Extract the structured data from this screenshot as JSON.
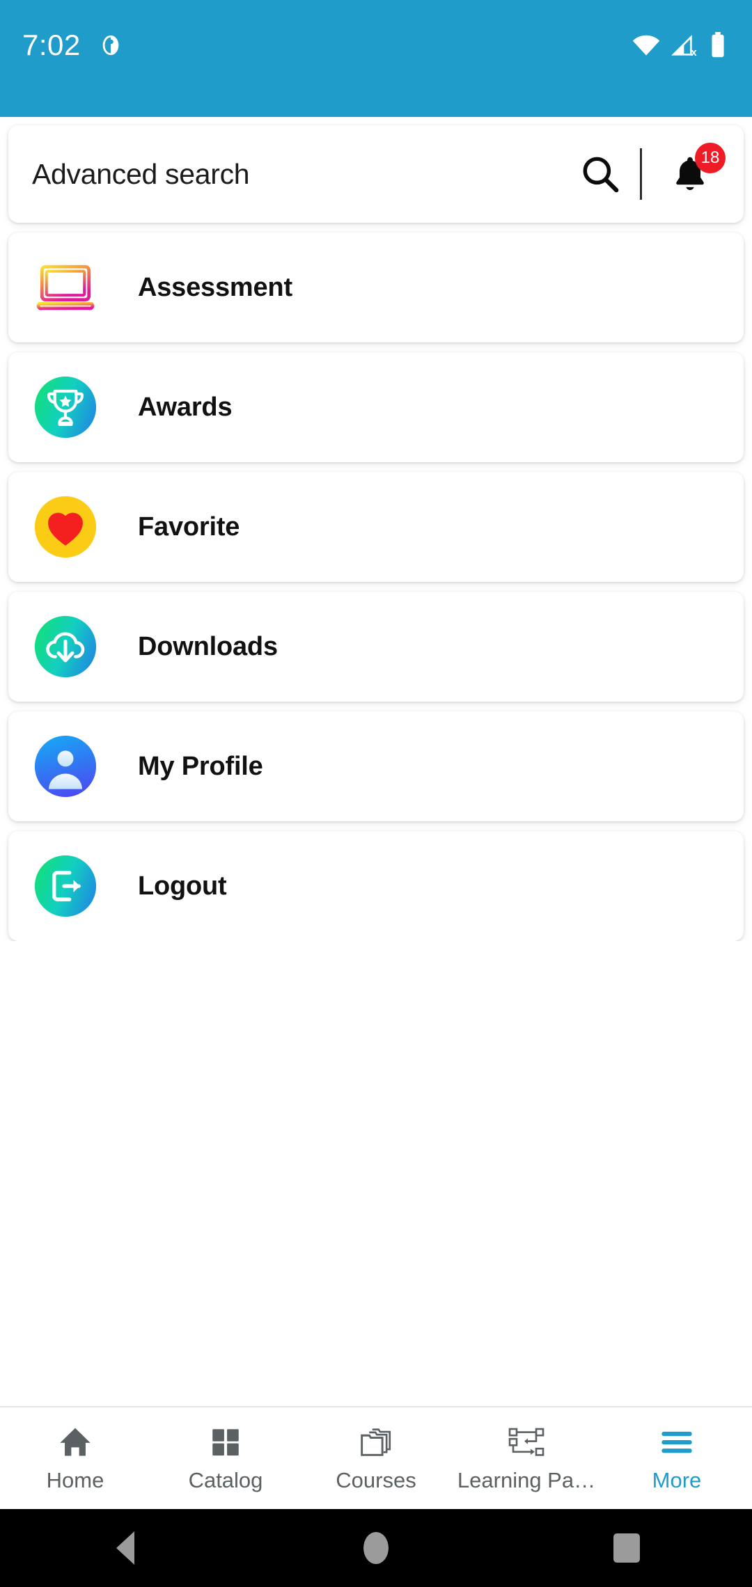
{
  "status_bar": {
    "time": "7:02",
    "app_icon": "app-notification-icon",
    "wifi_icon": "wifi-icon",
    "cellular_icon": "cellular-no-sim-icon",
    "battery_icon": "battery-icon",
    "background_color": "#1f9cc9"
  },
  "search": {
    "value": "Advanced search",
    "placeholder": "Advanced search",
    "search_icon": "search-icon",
    "bell_icon": "bell-icon",
    "notification_count": "18",
    "badge_color": "#ef1b26"
  },
  "menu": {
    "items": [
      {
        "label": "Assessment",
        "icon": "laptop-outline-icon",
        "icon_style": "outline-gradient-yellow-magenta"
      },
      {
        "label": "Awards",
        "icon": "trophy-icon",
        "icon_style": "circle-gradient-green-blue"
      },
      {
        "label": "Favorite",
        "icon": "heart-icon",
        "icon_style": "circle-yellow-red-heart"
      },
      {
        "label": "Downloads",
        "icon": "cloud-download-icon",
        "icon_style": "circle-gradient-green-blue"
      },
      {
        "label": "My Profile",
        "icon": "person-icon",
        "icon_style": "circle-gradient-cyan-indigo"
      },
      {
        "label": "Logout",
        "icon": "logout-icon",
        "icon_style": "circle-gradient-green-blue"
      }
    ]
  },
  "bottom_nav": {
    "active_color": "#1f9cc9",
    "inactive_color": "#5b6063",
    "items": [
      {
        "label": "Home",
        "icon": "home-icon",
        "active": false
      },
      {
        "label": "Catalog",
        "icon": "grid-icon",
        "active": false
      },
      {
        "label": "Courses",
        "icon": "folders-icon",
        "active": false
      },
      {
        "label": "Learning Pa…",
        "icon": "learning-path-icon",
        "active": false
      },
      {
        "label": "More",
        "icon": "hamburger-icon",
        "active": true
      }
    ]
  },
  "android_nav": {
    "back": "back-button",
    "home": "home-button",
    "recents": "recents-button"
  }
}
